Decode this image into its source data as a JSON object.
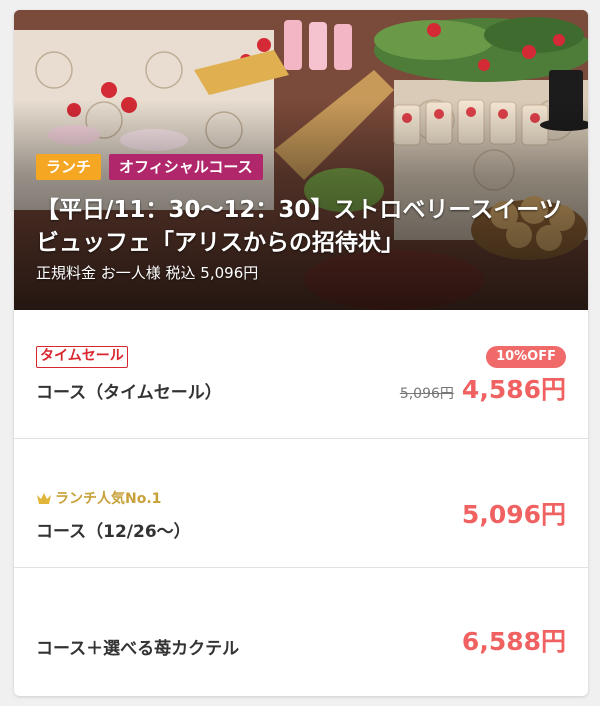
{
  "hero": {
    "tags": [
      "ランチ",
      "オフィシャルコース"
    ],
    "title_line1": "【平日/11：30〜12：30】ストロベリースイーツ",
    "title_line2": "ビュッフェ「アリスからの招待状」",
    "regular_price": "正規料金 お一人様 税込 5,096円"
  },
  "options": [
    {
      "badge": "タイムセール",
      "discount": "10%OFF",
      "name": "コース（タイムセール）",
      "old_price": "5,096円",
      "price": "4,586円"
    },
    {
      "rank": "ランチ人気No.1",
      "rank_icon": "crown-icon",
      "name": "コース（12/26〜）",
      "price": "5,096円"
    },
    {
      "name": "コース＋選べる苺カクテル",
      "price": "6,588円"
    }
  ],
  "colors": {
    "lunch_tag": "#f5a623",
    "official_tag": "#b0286b",
    "price": "#f06262",
    "sale_badge": "#d8262f",
    "rank": "#c9a13b"
  }
}
